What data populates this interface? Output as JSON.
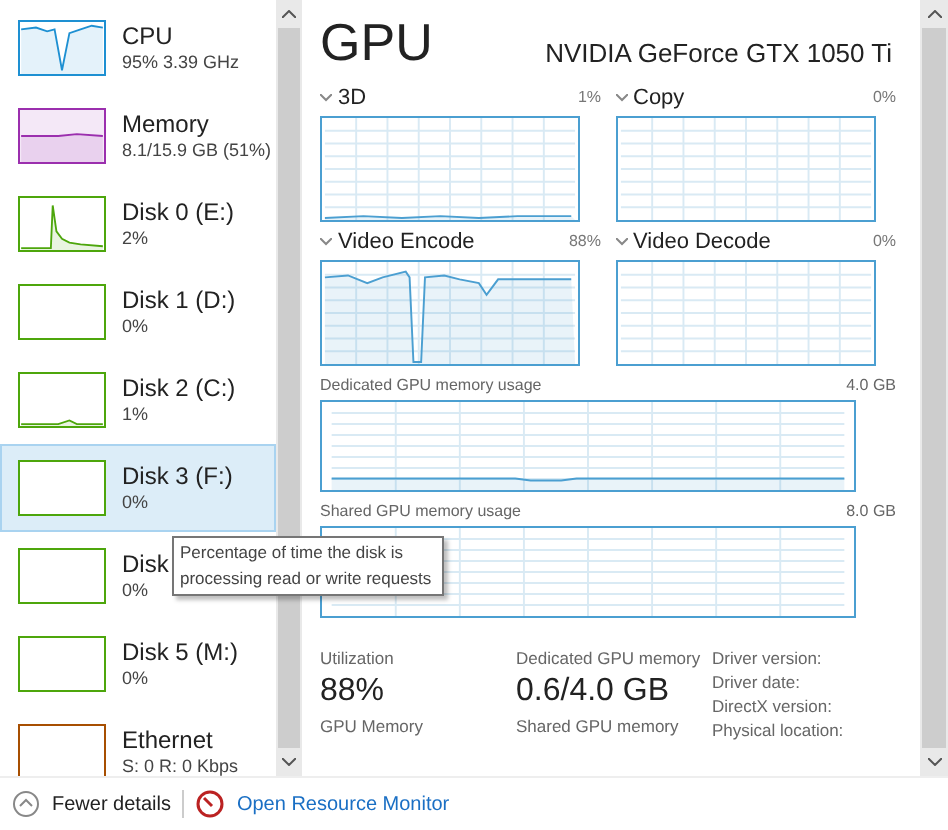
{
  "sidebar": {
    "items": [
      {
        "name": "CPU",
        "detail": "95% 3.39 GHz",
        "color": "#1e90d2",
        "selected": false
      },
      {
        "name": "Memory",
        "detail": "8.1/15.9 GB (51%)",
        "color": "#9b2fae",
        "selected": false
      },
      {
        "name": "Disk 0 (E:)",
        "detail": "2%",
        "color": "#4da60c",
        "selected": false
      },
      {
        "name": "Disk 1 (D:)",
        "detail": "0%",
        "color": "#4da60c",
        "selected": false
      },
      {
        "name": "Disk 2 (C:)",
        "detail": "1%",
        "color": "#4da60c",
        "selected": false
      },
      {
        "name": "Disk 3 (F:)",
        "detail": "0%",
        "color": "#4da60c",
        "selected": true
      },
      {
        "name": "Disk",
        "detail": "0%",
        "color": "#4da60c",
        "selected": false
      },
      {
        "name": "Disk 5 (M:)",
        "detail": "0%",
        "color": "#4da60c",
        "selected": false
      },
      {
        "name": "Ethernet",
        "detail": "S: 0 R: 0 Kbps",
        "color": "#a74f01",
        "selected": false
      }
    ]
  },
  "tooltip": "Percentage of time the disk is processing read or write requests",
  "main": {
    "title": "GPU",
    "device": "NVIDIA GeForce GTX 1050 Ti",
    "engines": [
      {
        "label": "3D",
        "value": "1%"
      },
      {
        "label": "Copy",
        "value": "0%"
      },
      {
        "label": "Video Encode",
        "value": "88%"
      },
      {
        "label": "Video Decode",
        "value": "0%"
      }
    ],
    "memory_graphs": [
      {
        "label": "Dedicated GPU memory usage",
        "value": "4.0 GB"
      },
      {
        "label": "Shared GPU memory usage",
        "value": "8.0 GB"
      }
    ],
    "stats": [
      {
        "label": "Utilization",
        "value": "88%"
      },
      {
        "label": "Dedicated GPU memory",
        "value": "0.6/4.0 GB"
      }
    ],
    "stat_labels": [
      "GPU Memory",
      "Shared GPU memory"
    ],
    "info_labels": [
      "Driver version:",
      "Driver date:",
      "DirectX version:",
      "Physical location:"
    ]
  },
  "footer": {
    "fewer": "Fewer details",
    "monitor": "Open Resource Monitor"
  }
}
